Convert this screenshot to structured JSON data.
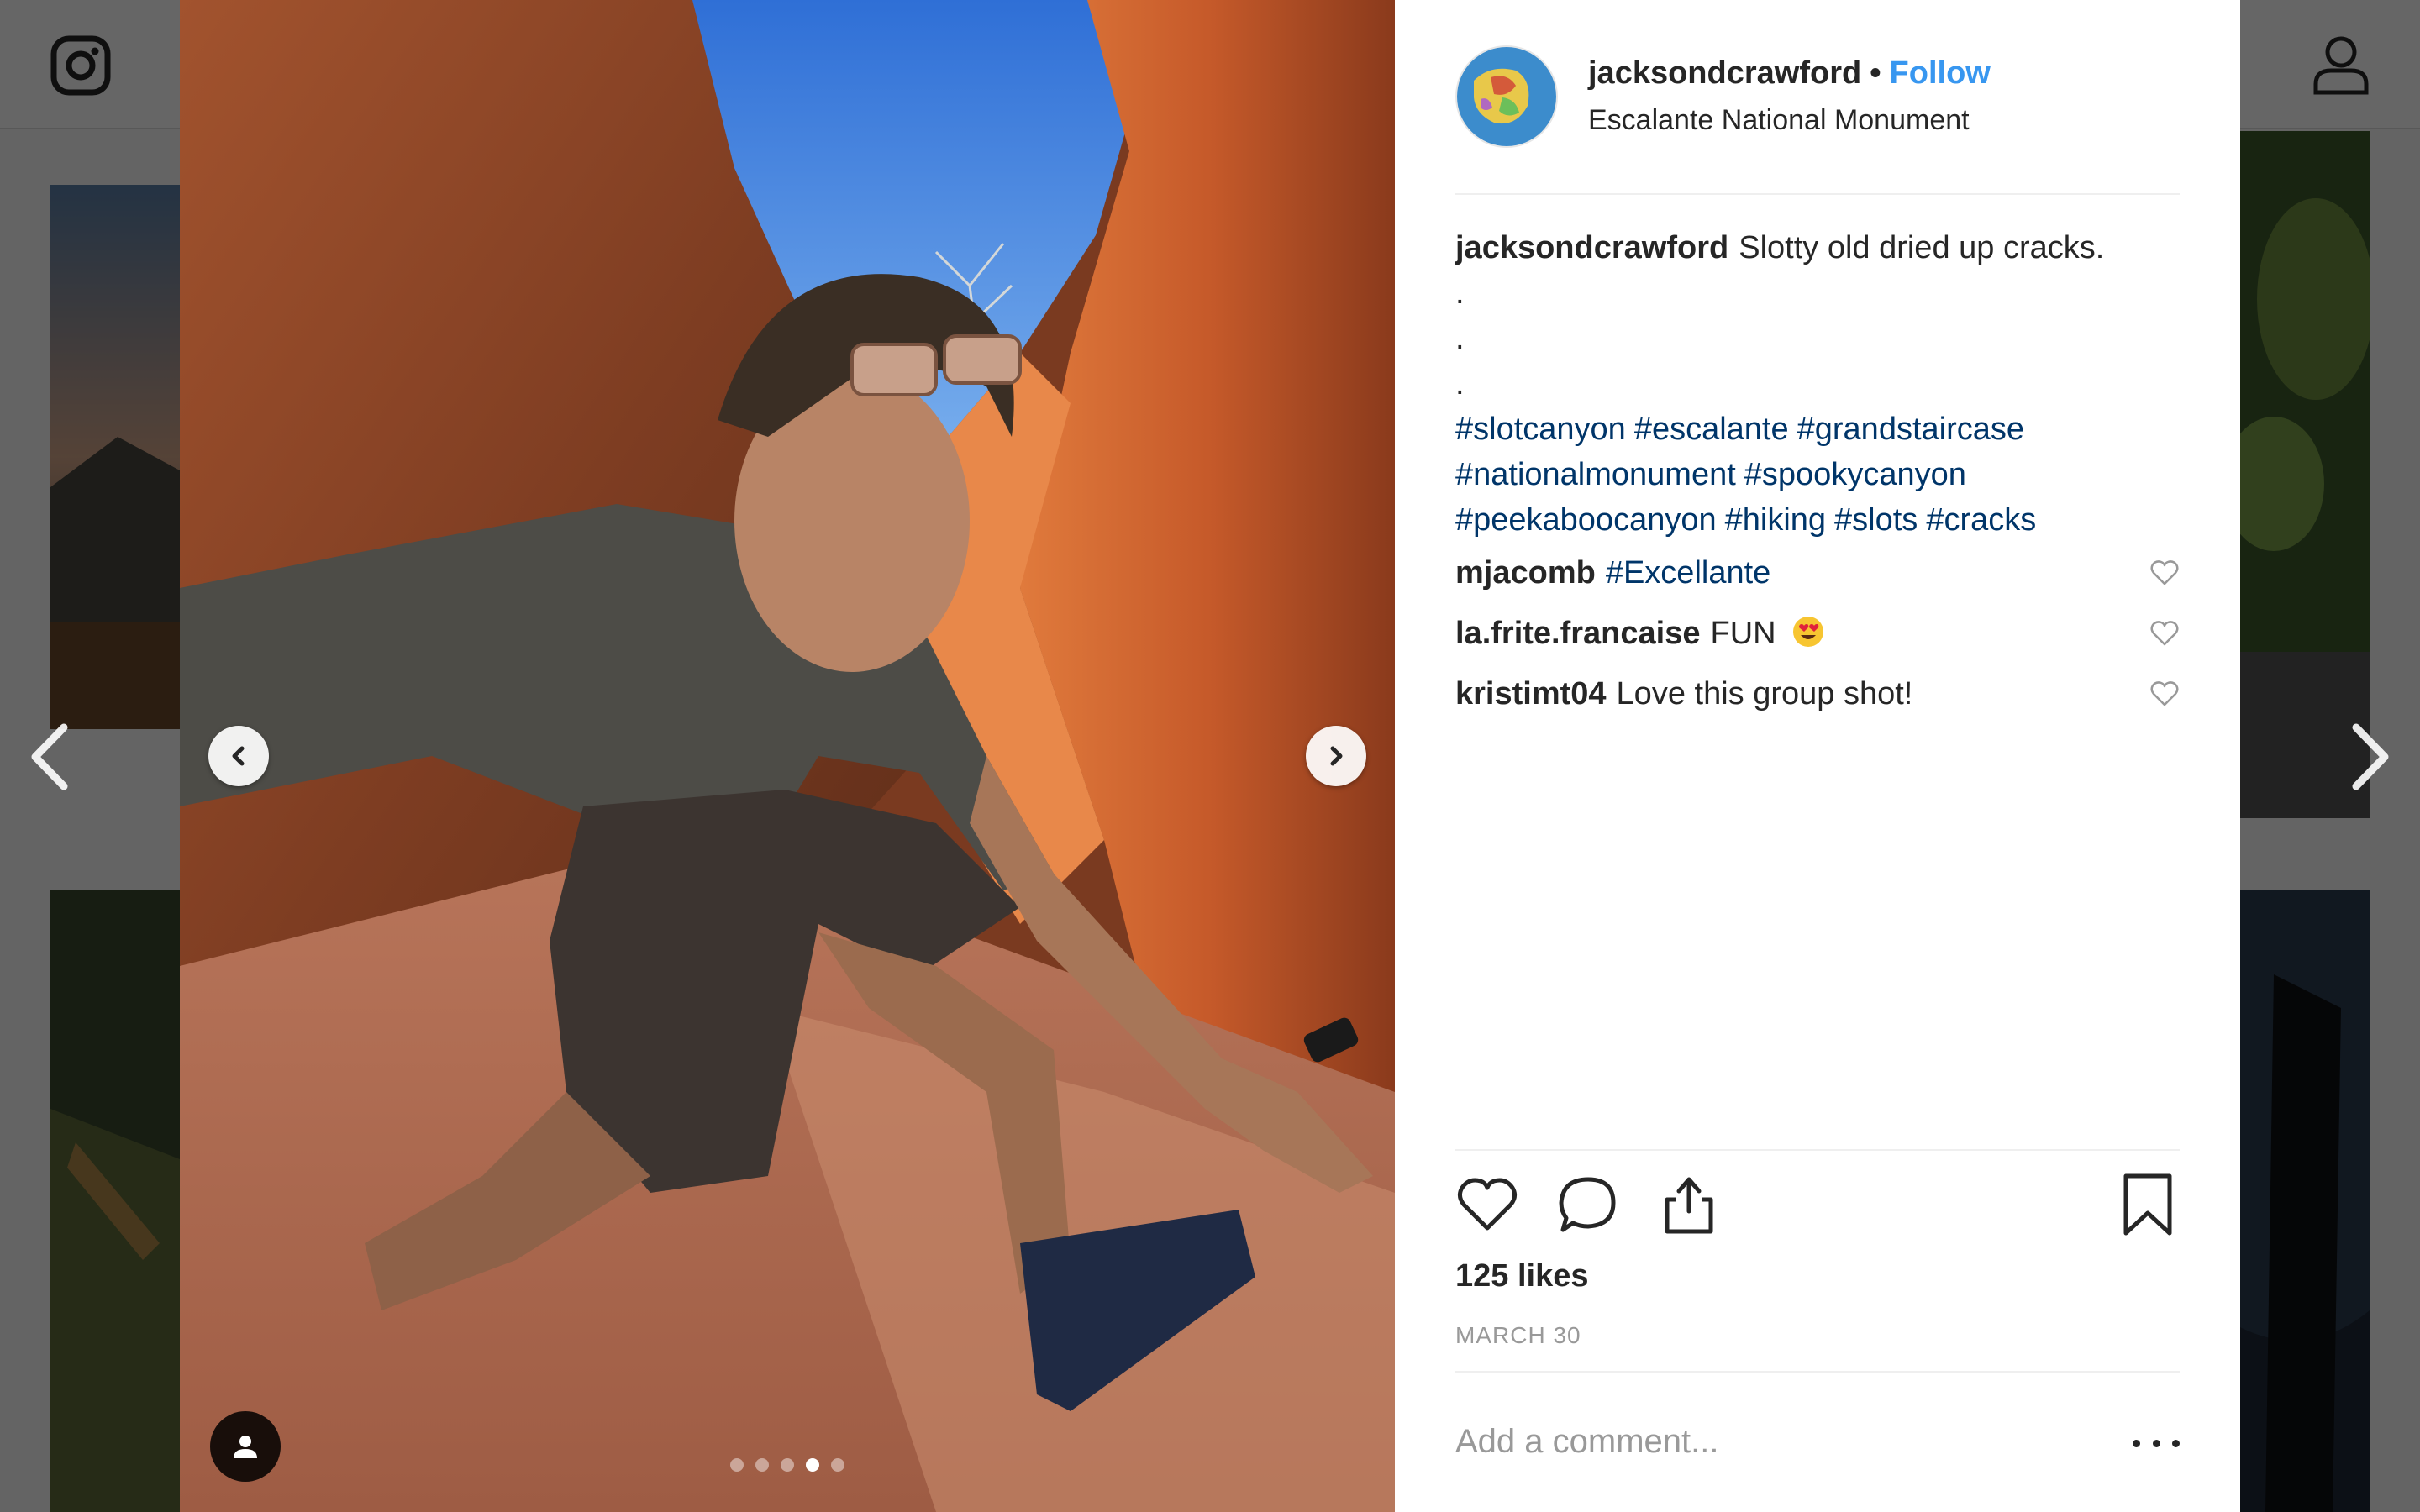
{
  "post": {
    "username": "jacksondcrawford",
    "separator": "•",
    "follow_label": "Follow",
    "location": "Escalante National Monument",
    "caption": {
      "username": "jacksondcrawford",
      "text": "Slotty old dried up cracks.",
      "dots": [
        ".",
        ".",
        "."
      ],
      "hashtags": [
        "#slotcanyon",
        "#escalante",
        "#grandstaircase",
        "#nationalmonument",
        "#spookycanyon",
        "#peekaboocanyon",
        "#hiking",
        "#slots",
        "#cracks"
      ]
    },
    "comments": [
      {
        "username": "mjacomb",
        "text": "#Excellante",
        "is_tag": true
      },
      {
        "username": "la.frite.francaise",
        "text": "FUN",
        "emoji": "😍"
      },
      {
        "username": "kristimt04",
        "text": "Love this group shot!"
      }
    ],
    "likes": "125 likes",
    "date": "MARCH 30",
    "add_comment_placeholder": "Add a comment...",
    "carousel": {
      "count": 5,
      "active_index": 3
    }
  },
  "icons": {
    "logo": "instagram-logo-icon",
    "profile": "user-icon",
    "prev": "chevron-left-icon",
    "next": "chevron-right-icon",
    "like": "heart-icon",
    "comment": "speech-bubble-icon",
    "share": "share-icon",
    "save": "bookmark-icon",
    "more": "more-horizontal-icon",
    "tag": "person-tag-icon"
  },
  "colors": {
    "link": "#3897f0",
    "hashtag": "#003569",
    "text": "#262626",
    "muted": "#999999"
  }
}
